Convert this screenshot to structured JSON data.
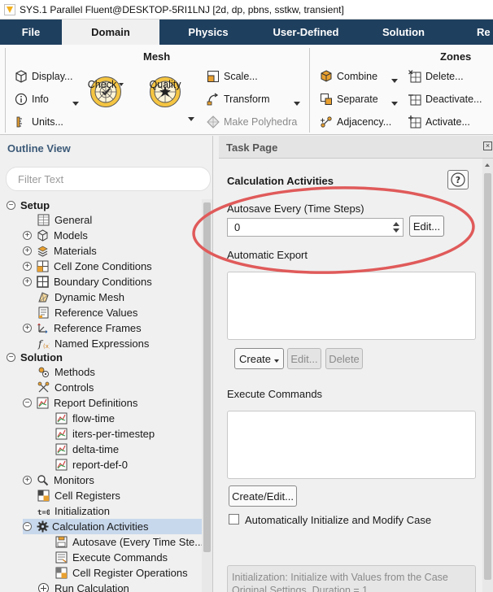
{
  "window": {
    "title": "SYS.1 Parallel Fluent@DESKTOP-5RI1LNJ  [2d, dp, pbns, sstkw, transient]"
  },
  "menu": {
    "tabs": [
      {
        "label": "File"
      },
      {
        "label": "Domain"
      },
      {
        "label": "Physics"
      },
      {
        "label": "User-Defined"
      },
      {
        "label": "Solution"
      },
      {
        "label": "Re"
      }
    ],
    "active": "Domain"
  },
  "ribbon": {
    "mesh": {
      "title": "Mesh",
      "display": "Display...",
      "info": "Info",
      "units": "Units...",
      "check": "Check",
      "quality": "Quality",
      "scale": "Scale...",
      "transform": "Transform",
      "make_polyhedra": "Make Polyhedra"
    },
    "zones": {
      "title": "Zones",
      "combine": "Combine",
      "separate": "Separate",
      "adjacency": "Adjacency...",
      "delete": "Delete...",
      "deactivate": "Deactivate...",
      "activate": "Activate..."
    }
  },
  "outline": {
    "title": "Outline View",
    "filter_placeholder": "Filter Text",
    "items": [
      {
        "label": "Setup",
        "bold": true
      },
      {
        "label": "General"
      },
      {
        "label": "Models"
      },
      {
        "label": "Materials"
      },
      {
        "label": "Cell Zone Conditions"
      },
      {
        "label": "Boundary Conditions"
      },
      {
        "label": "Dynamic Mesh"
      },
      {
        "label": "Reference Values"
      },
      {
        "label": "Reference Frames"
      },
      {
        "label": "Named Expressions"
      },
      {
        "label": "Solution",
        "bold": true
      },
      {
        "label": "Methods"
      },
      {
        "label": "Controls"
      },
      {
        "label": "Report Definitions"
      },
      {
        "label": "flow-time"
      },
      {
        "label": "iters-per-timestep"
      },
      {
        "label": "delta-time"
      },
      {
        "label": "report-def-0"
      },
      {
        "label": "Monitors"
      },
      {
        "label": "Cell Registers"
      },
      {
        "label": "Initialization"
      },
      {
        "label": "Calculation Activities",
        "selected": true
      },
      {
        "label": "Autosave (Every Time Ste..."
      },
      {
        "label": "Execute Commands"
      },
      {
        "label": "Cell Register Operations"
      },
      {
        "label": "Run Calculation"
      }
    ]
  },
  "task_page": {
    "header": "Task Page",
    "section_title": "Calculation Activities",
    "autosave_label": "Autosave Every (Time Steps)",
    "autosave_value": "0",
    "edit_button": "Edit...",
    "automatic_export_label": "Automatic Export",
    "create_button": "Create",
    "export_edit_button": "Edit...",
    "delete_button": "Delete",
    "execute_commands_label": "Execute Commands",
    "create_edit_button": "Create/Edit...",
    "auto_init_label": "Automatically Initialize and Modify Case",
    "auto_init_checked": false,
    "init_info_line1": "Initialization: Initialize with Values from the Case",
    "init_info_line2": "Original Settings, Duration = 1"
  },
  "colors": {
    "menubar": "#1f3f5e",
    "outline_header": "#3c5a78",
    "selected_row": "#c8d8ec",
    "highlight_ellipse": "#e05a5a"
  }
}
